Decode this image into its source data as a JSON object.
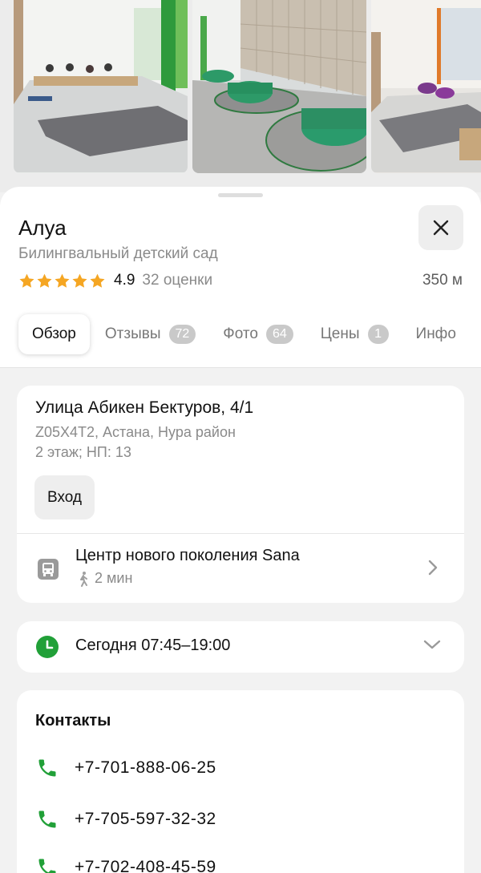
{
  "place": {
    "name": "Алуа",
    "category": "Билингвальный детский сад",
    "rating": "4.9",
    "rating_count": "32 оценки",
    "stars": 5,
    "distance": "350 м"
  },
  "tabs": [
    {
      "label": "Обзор",
      "badge": null,
      "active": true
    },
    {
      "label": "Отзывы",
      "badge": "72"
    },
    {
      "label": "Фото",
      "badge": "64"
    },
    {
      "label": "Цены",
      "badge": "1"
    },
    {
      "label": "Инфо",
      "badge": null
    }
  ],
  "address": {
    "street": "Улица Абикен Бектуров, 4/1",
    "city_line": "Z05X4T2, Астана, Нура район",
    "floor_line": "2 этаж; НП: 13",
    "entrance_label": "Вход"
  },
  "transit": {
    "stop_name": "Центр нового поколения Sana",
    "walk_time": "2 мин"
  },
  "hours": {
    "text": "Сегодня 07:45–19:00"
  },
  "contacts": {
    "title": "Контакты",
    "phones": [
      "+7-701-888-06-25",
      "+7-705-597-32-32",
      "+7-702-408-45-59"
    ]
  },
  "colors": {
    "star": "#f5a623",
    "accent_green": "#21a038",
    "badge": "#c9c9c9"
  }
}
